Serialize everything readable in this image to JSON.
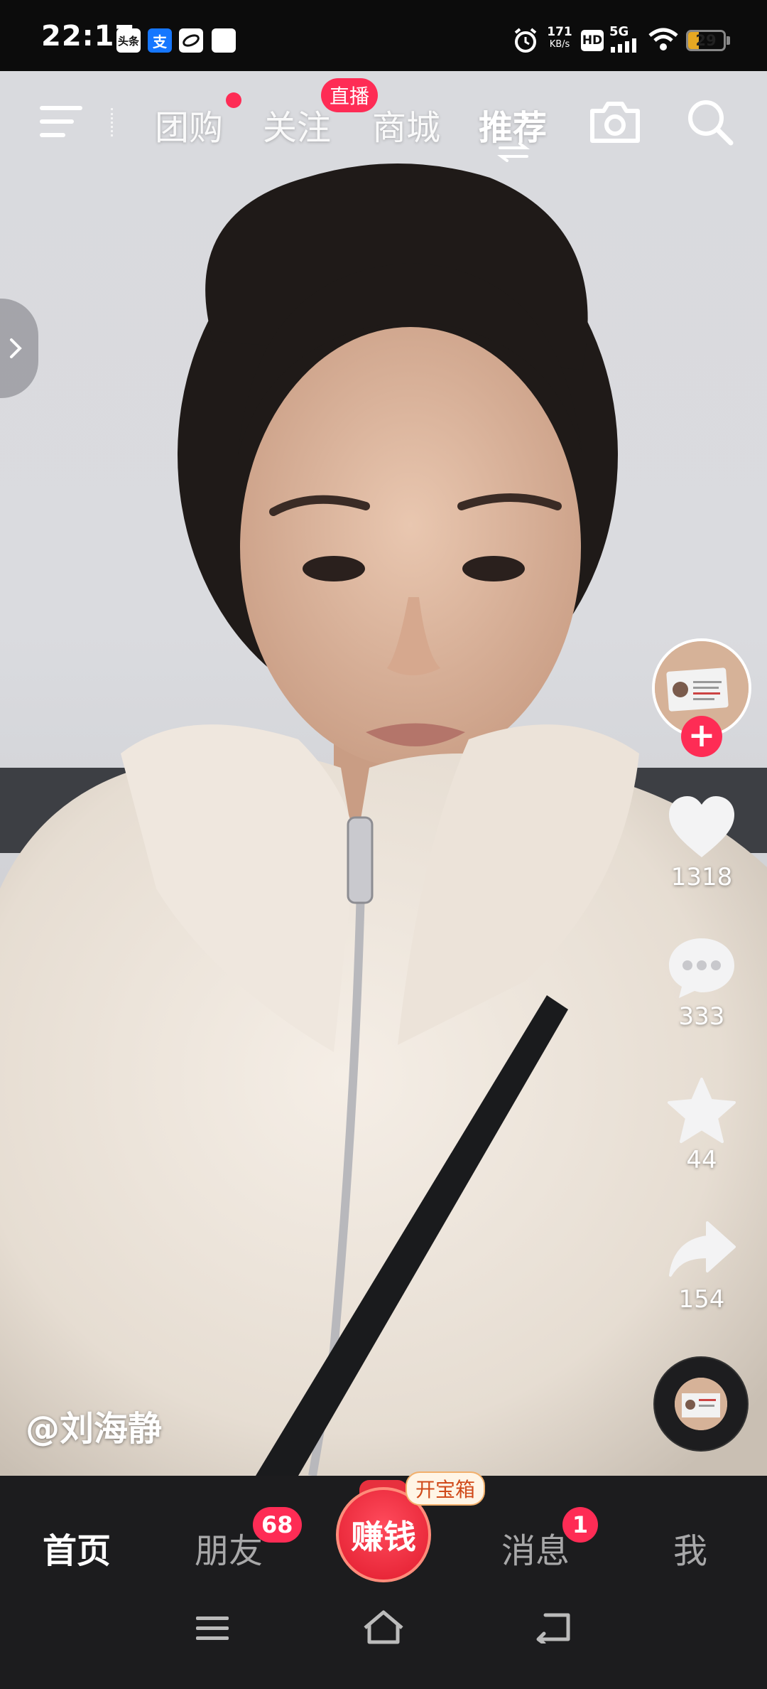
{
  "status_bar": {
    "time": "22:17",
    "app_icons": [
      "头条",
      "支",
      "",
      ""
    ],
    "net_speed_value": "171",
    "net_speed_unit": "KB/s",
    "hd_label": "HD",
    "network_label": "5G",
    "battery_level": 29,
    "battery_text": "29"
  },
  "top_nav": {
    "tabs": [
      "团购",
      "关注",
      "商城",
      "推荐"
    ],
    "active_tab": "推荐",
    "live_badge": "直播"
  },
  "video": {
    "author": "@刘海静"
  },
  "actions": {
    "likes": "1318",
    "comments": "333",
    "favorites": "44",
    "shares": "154"
  },
  "bottom_tabs": {
    "home": "首页",
    "friends": "朋友",
    "friends_badge": "68",
    "earn": "赚钱",
    "chest_label": "开宝箱",
    "messages": "消息",
    "messages_badge": "1",
    "me": "我"
  },
  "colors": {
    "accent": "#fe2c55",
    "tab_bar_bg": "#1c1c1e",
    "battery": "#e6a823"
  }
}
